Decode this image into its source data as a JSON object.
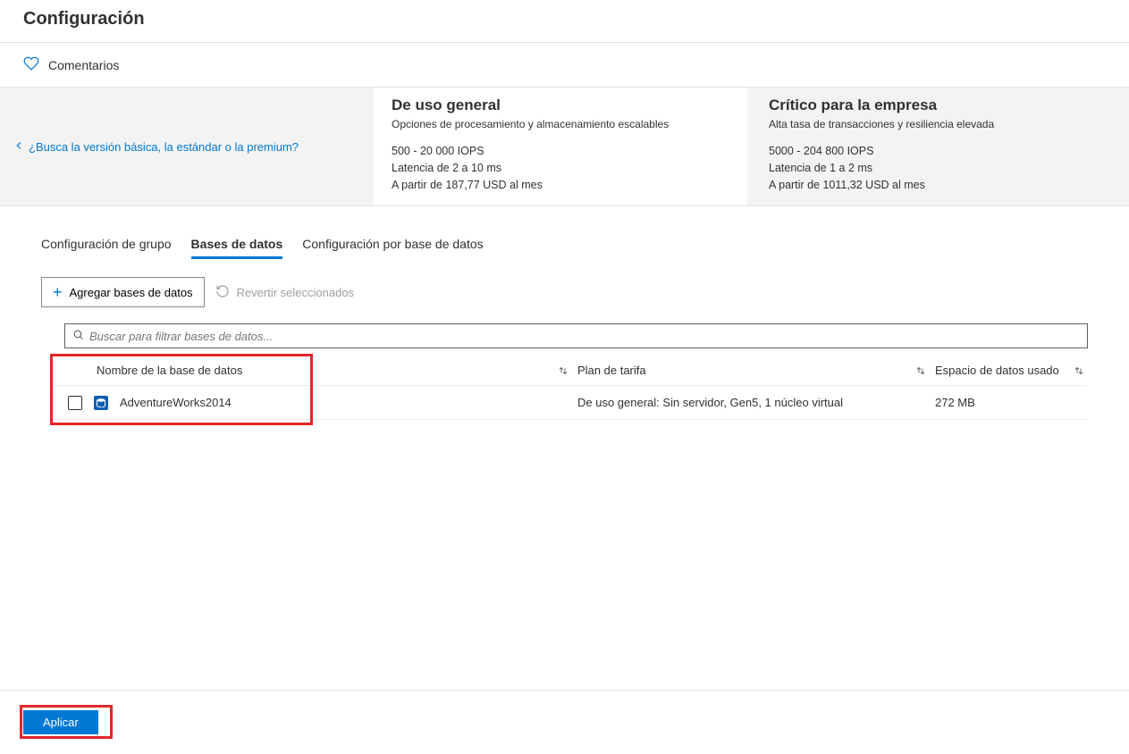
{
  "header": {
    "title": "Configuración"
  },
  "feedback": {
    "label": "Comentarios"
  },
  "tier_link": "¿Busca la versión básica, la estándar o la premium?",
  "tiers": {
    "general": {
      "title": "De uso general",
      "subtitle": "Opciones de procesamiento y almacenamiento escalables",
      "iops": "500 - 20 000 IOPS",
      "latency": "Latencia de 2 a 10 ms",
      "price": "A partir de 187,77 USD al mes"
    },
    "business": {
      "title": "Crítico para la empresa",
      "subtitle": "Alta tasa de transacciones y resiliencia elevada",
      "iops": "5000 - 204 800 IOPS",
      "latency": "Latencia de 1 a 2 ms",
      "price": "A partir de 1011,32 USD al mes"
    }
  },
  "tabs": {
    "group": "Configuración de grupo",
    "databases": "Bases de datos",
    "perdb": "Configuración por base de datos"
  },
  "toolbar": {
    "add": "Agregar bases de datos",
    "revert": "Revertir seleccionados"
  },
  "search": {
    "placeholder": "Buscar para filtrar bases de datos..."
  },
  "columns": {
    "name": "Nombre de la base de datos",
    "plan": "Plan de tarifa",
    "space": "Espacio de datos usado"
  },
  "rows": [
    {
      "name": "AdventureWorks2014",
      "plan": "De uso general: Sin servidor, Gen5, 1 núcleo virtual",
      "space": "272 MB"
    }
  ],
  "footer": {
    "apply": "Aplicar"
  }
}
